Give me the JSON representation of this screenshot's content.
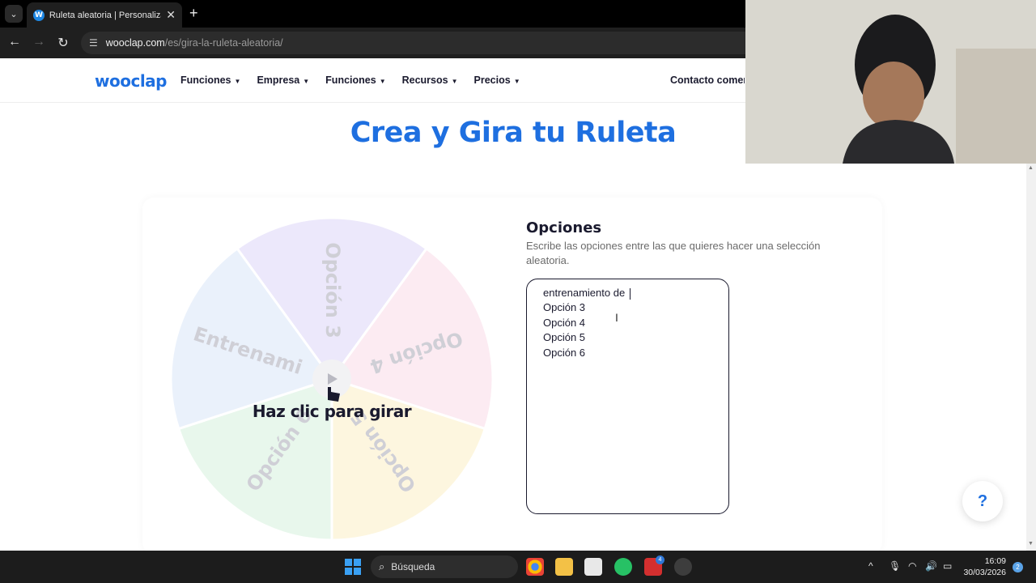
{
  "browser": {
    "tab_title": "Ruleta aleatoria | Personaliza y c",
    "favicon_letter": "W",
    "url_host": "wooclap.com",
    "url_path": "/es/gira-la-ruleta-aleatoria/"
  },
  "site": {
    "logo": "wooclap",
    "menu": [
      {
        "label": "Funciones"
      },
      {
        "label": "Empresa"
      },
      {
        "label": "Funciones"
      },
      {
        "label": "Recursos"
      },
      {
        "label": "Precios"
      }
    ],
    "contact": "Contacto comercial"
  },
  "page": {
    "title": "Crea y Gira tu Ruleta",
    "spin_label": "Haz clic para girar",
    "help_label": "?"
  },
  "wheel": {
    "segments": [
      {
        "label": "Opción 3",
        "color": "#ece8fb"
      },
      {
        "label": "Opción 4",
        "color": "#fcebf2"
      },
      {
        "label": "Opción 5",
        "color": "#fdf6df"
      },
      {
        "label": "Opción 6",
        "color": "#e8f7ec"
      },
      {
        "label": "Entrenami",
        "color": "#eaf1fb"
      }
    ]
  },
  "options": {
    "title": "Opciones",
    "description": "Escribe las opciones entre las que quieres hacer una selección aleatoria.",
    "lines": [
      "entrenamiento de ",
      "Opción 3",
      "Opción 4",
      "Opción 5",
      "Opción 6"
    ]
  },
  "taskbar": {
    "search_placeholder": "Búsqueda",
    "time": "16:09",
    "date": "30/03/2026",
    "notifications": "2",
    "app_badge": "4"
  },
  "colors": {
    "brand_blue": "#1e6fe0",
    "text_dark": "#1a1a2e"
  }
}
